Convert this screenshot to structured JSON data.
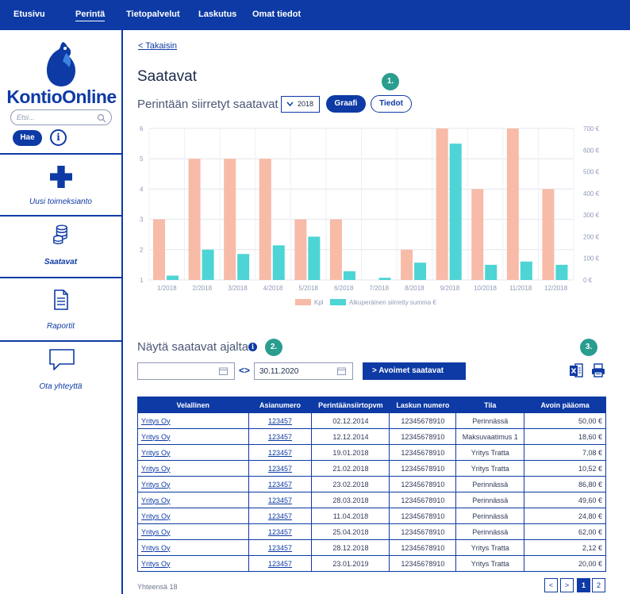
{
  "nav": {
    "items": [
      "Etusivu",
      "Perintä",
      "Tietopalvelut",
      "Laskutus",
      "Omat tiedot"
    ],
    "active": "Perintä"
  },
  "sidebar": {
    "brand": "KontioOnline",
    "search_placeholder": "Etsi...",
    "search_button": "Hae",
    "info_icon": "i",
    "items": [
      {
        "label": "Uusi toimeksianto",
        "icon": "plus-icon"
      },
      {
        "label": "Saatavat",
        "icon": "coins-icon",
        "active": true
      },
      {
        "label": "Raportit",
        "icon": "document-icon"
      },
      {
        "label": "Ota yhteyttä",
        "icon": "speech-bubble-icon"
      }
    ]
  },
  "main": {
    "back": "< Takaisin",
    "title": "Saatavat",
    "subtitle": "Perintään siirretyt saatavat",
    "year": "2018",
    "graph_button": "Graafi",
    "info_button": "Tiedot",
    "markers": [
      "1.",
      "2.",
      "3."
    ],
    "filter_title": "Näytä saatavat ajalta:",
    "filter_info": "i",
    "date_from": "",
    "date_to": "30.11.2020",
    "range_icon": "<>",
    "open_button": "> Avoimet saatavat",
    "total": "Yhteensä 18"
  },
  "colors": {
    "primary": "#0d3aa5",
    "bar_kpl": "#f7bba8",
    "bar_sum": "#4dd4d4",
    "marker": "#2a9d8f"
  },
  "chart_data": {
    "type": "bar",
    "categories": [
      "1/2018",
      "2/2018",
      "3/2018",
      "4/2018",
      "5/2018",
      "6/2018",
      "7/2018",
      "8/2018",
      "9/2018",
      "10/2018",
      "11/2018",
      "12/2018"
    ],
    "series": [
      {
        "name": "Kpl",
        "axis": "left",
        "values": [
          3,
          5,
          5,
          5,
          3,
          3,
          0,
          2,
          6,
          4,
          6,
          4
        ]
      },
      {
        "name": "Alkuperäinen siirretty summa €",
        "axis": "right",
        "values": [
          20,
          140,
          120,
          160,
          200,
          40,
          10,
          80,
          630,
          70,
          85,
          70
        ]
      }
    ],
    "y_left": {
      "ticks": [
        "1",
        "2",
        "3",
        "4",
        "5",
        "6"
      ],
      "ylim": [
        1,
        6
      ]
    },
    "y_right": {
      "ticks": [
        "0 €",
        "100 €",
        "200 €",
        "300 €",
        "400 €",
        "500 €",
        "600 €",
        "700 €"
      ],
      "ylim": [
        0,
        700
      ]
    },
    "legend": "bottom",
    "grid": true
  },
  "table": {
    "columns": [
      "Velallinen",
      "Asianumero",
      "Perintäänsiirtopvm",
      "Laskun numero",
      "Tila",
      "Avoin pääoma"
    ],
    "rows": [
      [
        "Yritys Oy",
        "123457",
        "02.12.2014",
        "12345678910",
        "Perinnässä",
        "50,00 €"
      ],
      [
        "Yritys Oy",
        "123457",
        "12.12.2014",
        "12345678910",
        "Maksuvaatimus 1",
        "18,60 €"
      ],
      [
        "Yritys Oy",
        "123457",
        "19.01.2018",
        "12345678910",
        "Yritys Tratta",
        "7,08 €"
      ],
      [
        "Yritys Oy",
        "123457",
        "21.02.2018",
        "12345678910",
        "Yritys Tratta",
        "10,52 €"
      ],
      [
        "Yritys Oy",
        "123457",
        "23.02.2018",
        "12345678910",
        "Perinnässä",
        "86,80 €"
      ],
      [
        "Yritys Oy",
        "123457",
        "28.03.2018",
        "12345678910",
        "Perinnässä",
        "49,60 €"
      ],
      [
        "Yritys Oy",
        "123457",
        "11.04.2018",
        "12345678910",
        "Perinnässä",
        "24,80 €"
      ],
      [
        "Yritys Oy",
        "123457",
        "25.04.2018",
        "12345678910",
        "Perinnässä",
        "62,00 €"
      ],
      [
        "Yritys Oy",
        "123457",
        "28.12.2018",
        "12345678910",
        "Yritys Tratta",
        "2,12 €"
      ],
      [
        "Yritys Oy",
        "123457",
        "23.01.2019",
        "12345678910",
        "Yritys Tratta",
        "20,00 €"
      ]
    ]
  },
  "pagination": {
    "prev": "<",
    "next": ">",
    "pages": [
      "1",
      "2"
    ],
    "current": "1"
  }
}
